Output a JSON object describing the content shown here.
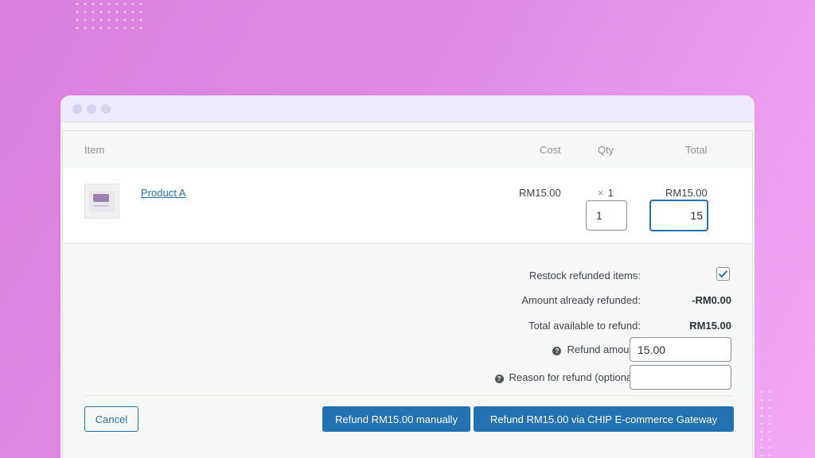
{
  "table": {
    "headers": {
      "item": "Item",
      "cost": "Cost",
      "qty": "Qty",
      "total": "Total"
    },
    "rows": [
      {
        "product": "Product A",
        "cost": "RM15.00",
        "qty_prefix": "×",
        "qty": "1",
        "total": "RM15.00",
        "refund_qty_value": "1",
        "refund_total_value": "15"
      }
    ]
  },
  "refund": {
    "restock_label": "Restock refunded items:",
    "restock_checked": true,
    "already_label": "Amount already refunded:",
    "already_value": "-RM0.00",
    "available_label": "Total available to refund:",
    "available_value": "RM15.00",
    "amount_label": "Refund amount:",
    "amount_value": "15.00",
    "reason_label": "Reason for refund (optional):",
    "reason_value": ""
  },
  "buttons": {
    "cancel": "Cancel",
    "manual": "Refund RM15.00 manually",
    "gateway": "Refund RM15.00 via CHIP E-commerce Gateway"
  },
  "colors": {
    "accent": "#2271b1",
    "background_from": "#d97fdc",
    "background_to": "#f2a9f5"
  }
}
